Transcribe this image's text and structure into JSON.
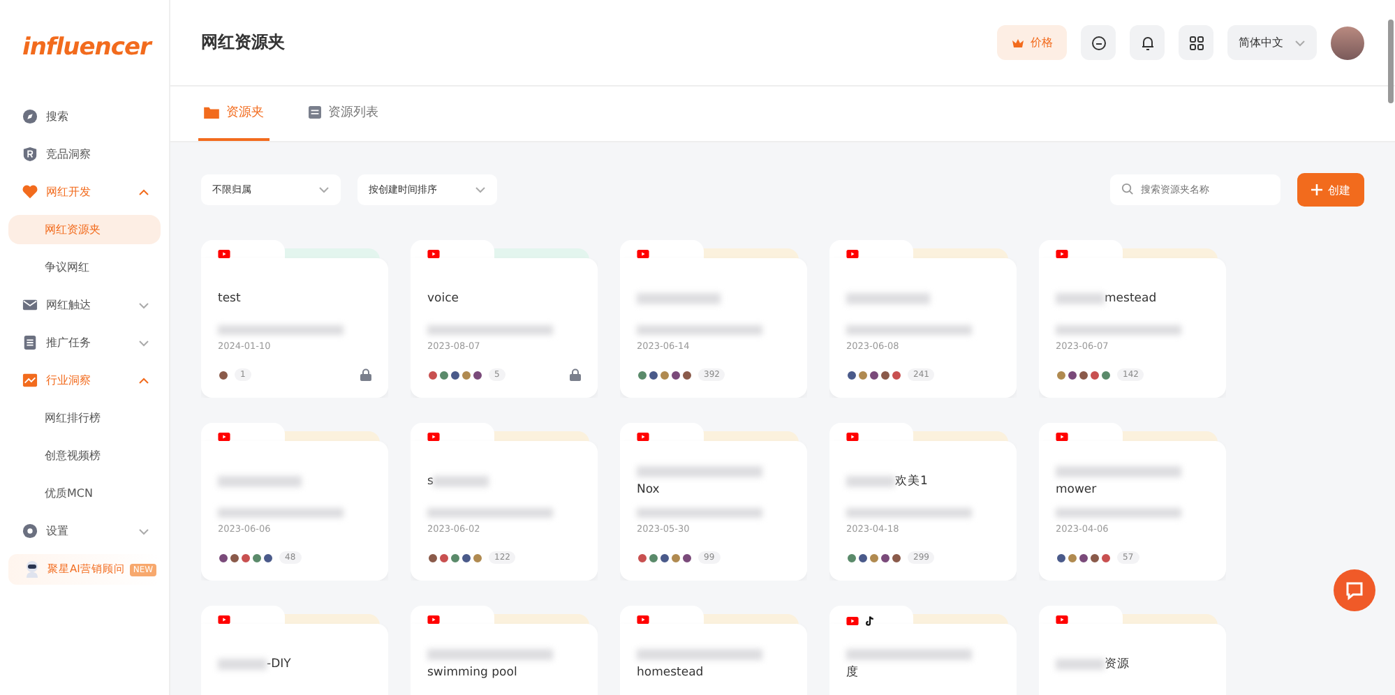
{
  "logo": {
    "text": "influencer"
  },
  "sidebar": {
    "items": [
      {
        "label": "搜索"
      },
      {
        "label": "竞品洞察"
      },
      {
        "label": "网红开发",
        "expanded": true,
        "children": [
          {
            "label": "网红资源夹",
            "selected": true
          },
          {
            "label": "争议网红",
            "selected": false
          }
        ]
      },
      {
        "label": "网红触达",
        "expanded": false
      },
      {
        "label": "推广任务",
        "expanded": false
      },
      {
        "label": "行业洞察",
        "expanded": true,
        "children": [
          {
            "label": "网红排行榜",
            "selected": false
          },
          {
            "label": "创意视频榜",
            "selected": false
          },
          {
            "label": "优质MCN",
            "selected": false
          }
        ]
      },
      {
        "label": "设置",
        "expanded": false
      }
    ],
    "assistant": {
      "label": "聚星AI营销顾问",
      "badge": "NEW"
    }
  },
  "header": {
    "title": "网红资源夹",
    "price_button": "价格",
    "language": "简体中文"
  },
  "tabs": [
    {
      "label": "资源夹",
      "selected": true
    },
    {
      "label": "资源列表",
      "selected": false
    }
  ],
  "filters": [
    {
      "label": "不限归属"
    },
    {
      "label": "按创建时间排序"
    }
  ],
  "search": {
    "placeholder": "搜索资源夹名称"
  },
  "create_button": "创建",
  "folders": [
    {
      "title": "test",
      "kind": "plain",
      "date": "2024-01-10",
      "count": "1",
      "locked": true,
      "color": "#e3f5ee",
      "platforms": [
        {
          "kind": "youtube"
        }
      ]
    },
    {
      "title": "voice",
      "kind": "plain",
      "date": "2023-08-07",
      "count": "5",
      "locked": true,
      "color": "#e3f5ee",
      "platforms": [
        {
          "kind": "youtube"
        }
      ]
    },
    {
      "kind": "blur_only",
      "date": "2023-06-14",
      "count": "392",
      "locked": false,
      "color": "#fbf1dd",
      "platforms": [
        {
          "kind": "youtube"
        }
      ]
    },
    {
      "kind": "blur_only",
      "date": "2023-06-08",
      "count": "241",
      "locked": false,
      "color": "#fbf1dd",
      "platforms": [
        {
          "kind": "youtube"
        }
      ]
    },
    {
      "title": "mestead",
      "kind": "after_blur",
      "date": "2023-06-07",
      "count": "142",
      "locked": false,
      "color": "#fbf1dd",
      "platforms": [
        {
          "kind": "youtube"
        }
      ]
    },
    {
      "kind": "blur_only",
      "date": "2023-06-06",
      "count": "48",
      "locked": false,
      "color": "#fbf1dd",
      "platforms": [
        {
          "kind": "youtube"
        }
      ]
    },
    {
      "title": "s",
      "kind": "before_blur",
      "date": "2023-06-02",
      "count": "122",
      "locked": false,
      "color": "#fbf1dd",
      "platforms": [
        {
          "kind": "youtube"
        }
      ]
    },
    {
      "title": "Nox",
      "kind": "below_blur",
      "date": "2023-05-30",
      "count": "99",
      "locked": false,
      "color": "#fbf1dd",
      "platforms": [
        {
          "kind": "youtube"
        }
      ]
    },
    {
      "title": "欢美1",
      "kind": "after_blur",
      "date": "2023-04-18",
      "count": "299",
      "locked": false,
      "color": "#fbf1dd",
      "platforms": [
        {
          "kind": "youtube"
        }
      ]
    },
    {
      "title": "mower",
      "kind": "below_blur",
      "date": "2023-04-06",
      "count": "57",
      "locked": false,
      "color": "#fbf1dd",
      "platforms": [
        {
          "kind": "youtube"
        }
      ]
    },
    {
      "title": "-DIY",
      "kind": "after_blur",
      "color": "#fbf1dd",
      "platforms": [
        {
          "kind": "youtube"
        }
      ]
    },
    {
      "title": "swimming pool",
      "kind": "below_blur",
      "color": "#fbf1dd",
      "platforms": [
        {
          "kind": "youtube"
        }
      ]
    },
    {
      "title": "homestead",
      "kind": "below_blur",
      "color": "#fbf1dd",
      "platforms": [
        {
          "kind": "youtube"
        }
      ]
    },
    {
      "title": "度",
      "kind": "below_blur",
      "color": "#fbf1dd",
      "platforms": [
        {
          "kind": "youtube"
        },
        {
          "kind": "tiktok"
        }
      ]
    },
    {
      "title": "资源",
      "kind": "after_blur",
      "color": "#fbf1dd",
      "platforms": [
        {
          "kind": "youtube"
        }
      ]
    }
  ]
}
